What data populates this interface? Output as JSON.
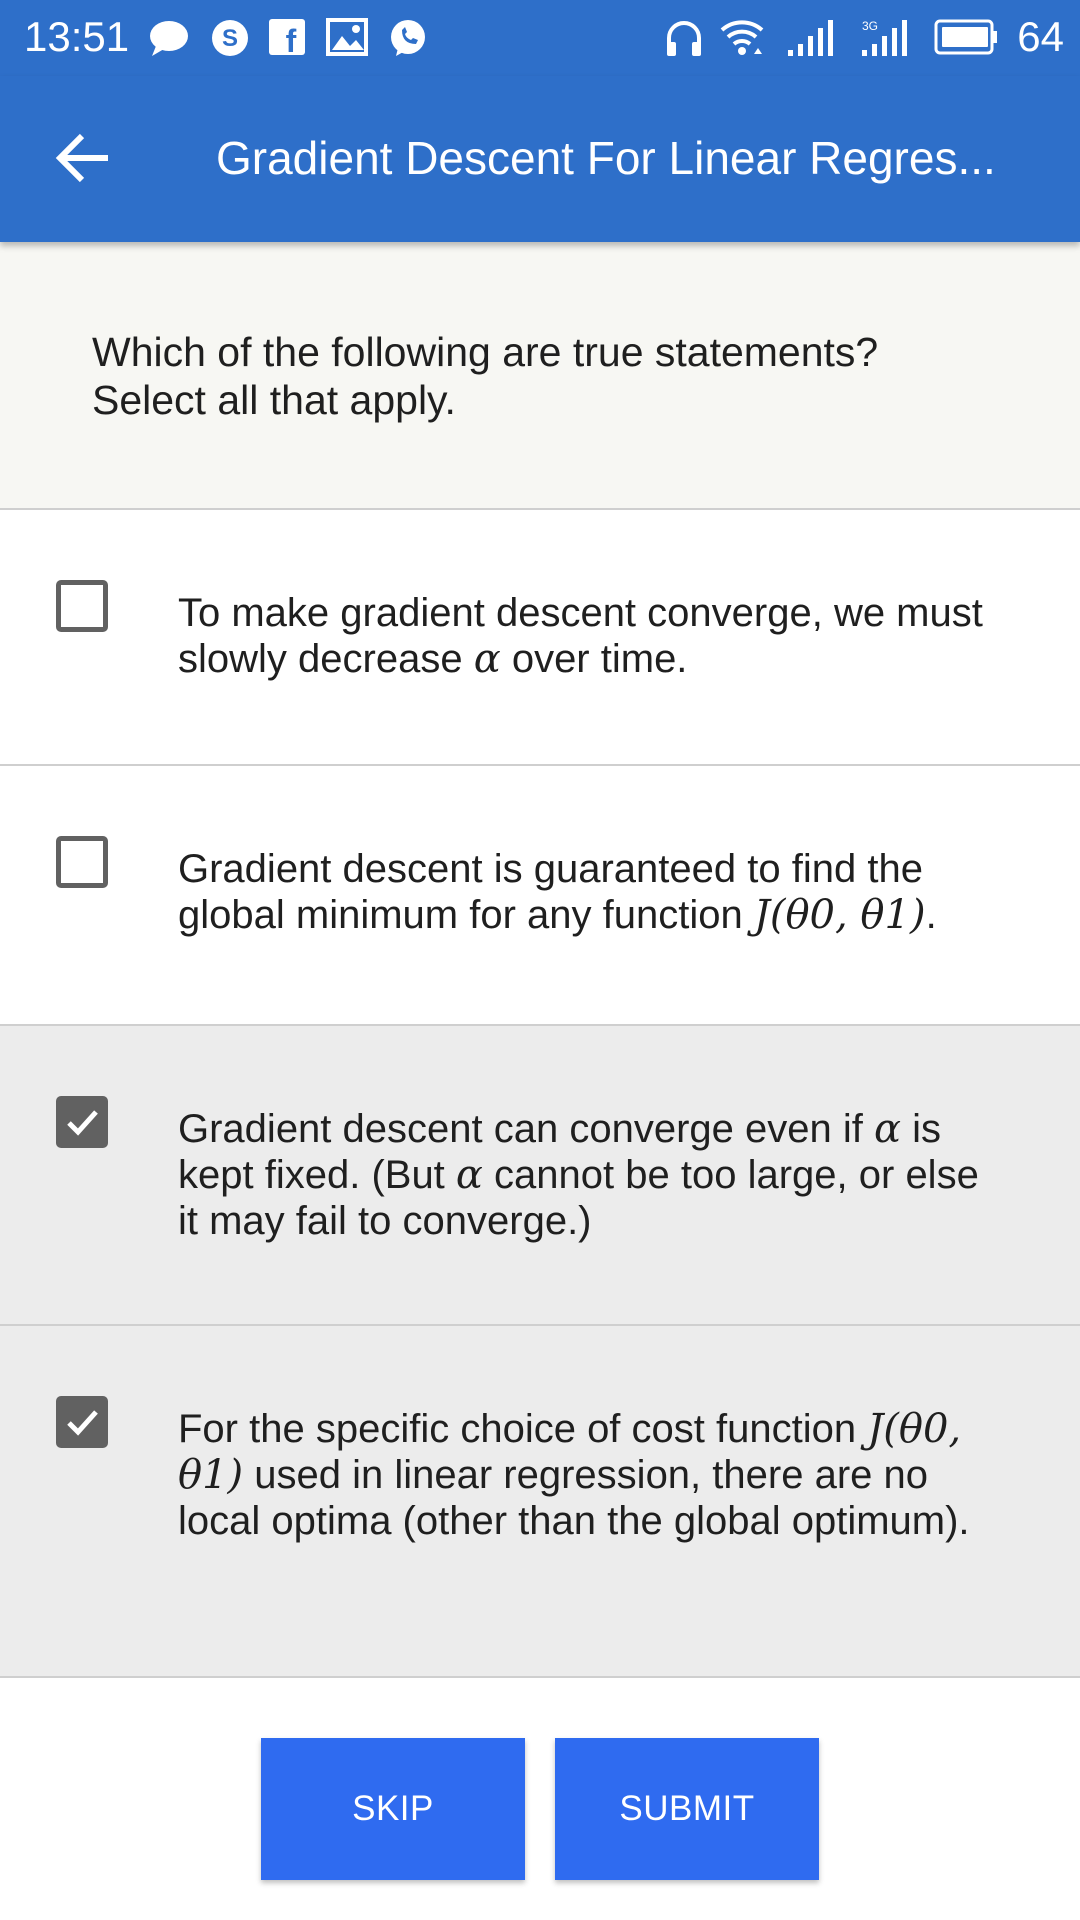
{
  "status_bar": {
    "time": "13:51",
    "battery": "64",
    "left_icons": [
      "chat-bubble-icon",
      "skype-icon",
      "facebook-icon",
      "gallery-icon",
      "viber-icon"
    ],
    "right_icons": [
      "headphones-icon",
      "wifi-icon",
      "signal-icon",
      "signal-3g-icon",
      "battery-icon"
    ]
  },
  "app_bar": {
    "title": "Gradient Descent For Linear Regres...",
    "back_icon": "arrow-left-icon",
    "color": "#2e6fc9"
  },
  "question": {
    "line1": "Which of the following are true statements?",
    "line2": "Select all that apply."
  },
  "options": [
    {
      "checked": false,
      "parts": [
        "To make gradient descent converge, we must slowly decrease ",
        "α",
        " over time."
      ]
    },
    {
      "checked": false,
      "parts": [
        "Gradient descent is guaranteed to find the global minimum for any function ",
        "J(θ0, θ1)",
        "."
      ]
    },
    {
      "checked": true,
      "parts": [
        "Gradient descent can converge even if ",
        "α",
        " is kept fixed. (But ",
        "α",
        " cannot be too large, or else it may fail to converge.)"
      ]
    },
    {
      "checked": true,
      "parts": [
        "For the specific choice of cost function ",
        "J(θ0, θ1)",
        " used in linear regression, there are no local optima (other than the global optimum)."
      ]
    }
  ],
  "buttons": {
    "skip": "SKIP",
    "submit": "SUBMIT",
    "color": "#2f6bf0"
  }
}
